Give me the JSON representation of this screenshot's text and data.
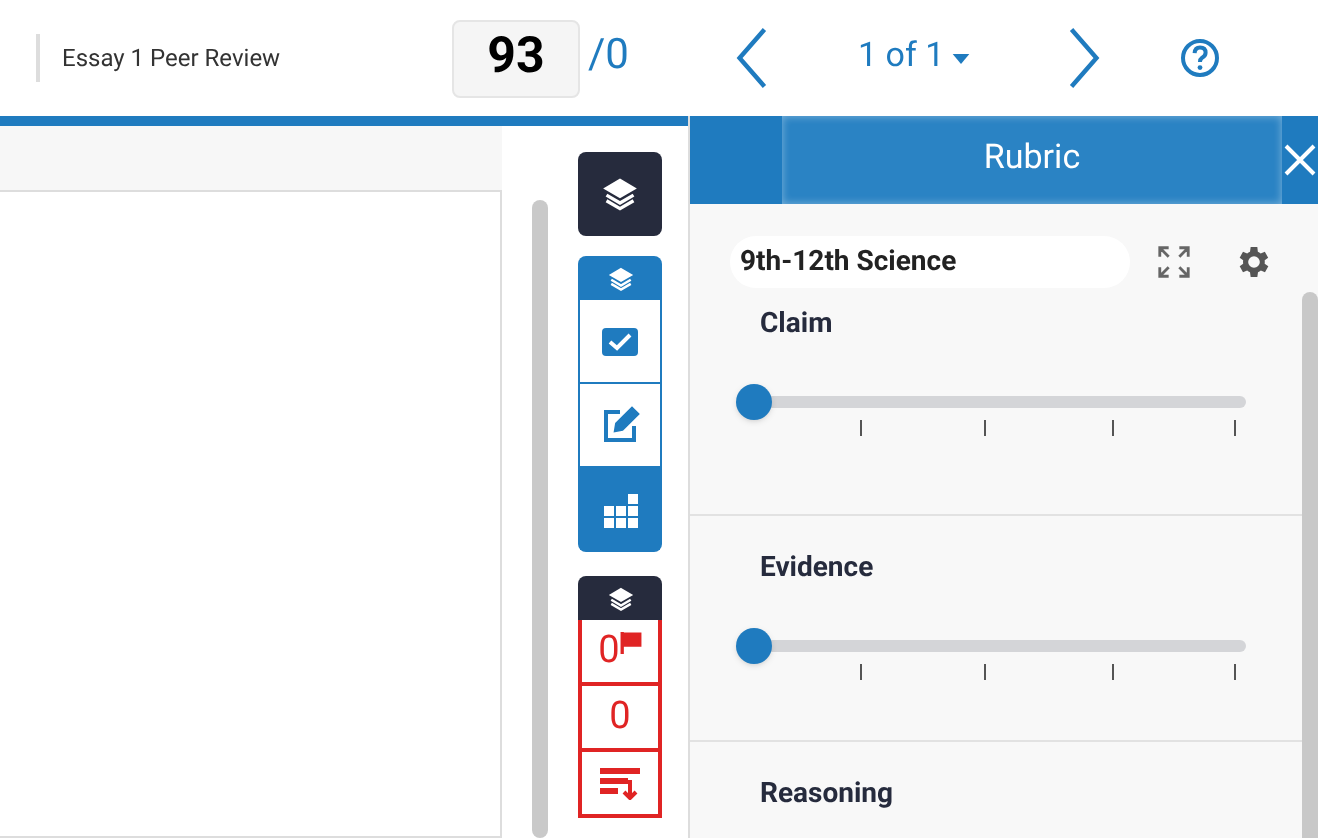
{
  "header": {
    "title": "Essay 1 Peer Review",
    "score": "93",
    "total": "/0",
    "pager": "1 of 1"
  },
  "toolbar": {
    "tools": [
      {
        "kind": "check",
        "selected": false
      },
      {
        "kind": "edit",
        "selected": false
      },
      {
        "kind": "grid",
        "selected": true
      }
    ],
    "flags": [
      {
        "kind": "flag",
        "text": "0"
      },
      {
        "kind": "count",
        "text": "0"
      },
      {
        "kind": "sort"
      }
    ]
  },
  "rubric": {
    "title": "Rubric",
    "set": "9th-12th Science",
    "criteria": [
      {
        "name": "Claim",
        "level": 0
      },
      {
        "name": "Evidence",
        "level": 0
      },
      {
        "name": "Reasoning"
      }
    ]
  }
}
